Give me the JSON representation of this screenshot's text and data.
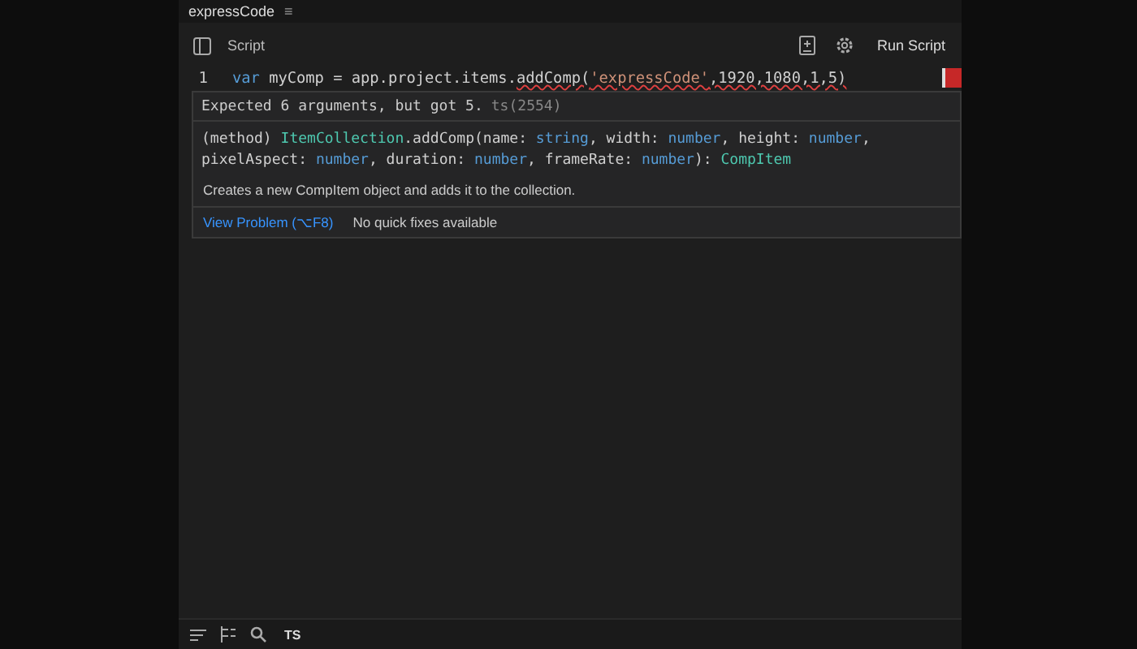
{
  "window": {
    "title": "expressCode",
    "menu_glyph": "≡"
  },
  "toolbar": {
    "label": "Script",
    "run_button": "Run Script"
  },
  "editor": {
    "lines": [
      {
        "number": "1",
        "has_error": true,
        "tokens": [
          {
            "kind": "keyword",
            "text": "var",
            "error": false
          },
          {
            "kind": "plain",
            "text": " myComp = app.project.items.",
            "error": false
          },
          {
            "kind": "plain",
            "text": "addComp(",
            "error": true
          },
          {
            "kind": "string",
            "text": "'expressCode'",
            "error": true
          },
          {
            "kind": "plain",
            "text": ",1920,1080,1,5)",
            "error": true
          }
        ]
      }
    ]
  },
  "tooltip": {
    "message": "Expected 6 arguments, but got 5.",
    "code": "ts(2554)",
    "signature": [
      {
        "kind": "plain",
        "text": "(method) "
      },
      {
        "kind": "type",
        "text": "ItemCollection"
      },
      {
        "kind": "plain",
        "text": ".addComp(name: "
      },
      {
        "kind": "keyword",
        "text": "string"
      },
      {
        "kind": "plain",
        "text": ", width: "
      },
      {
        "kind": "keyword",
        "text": "number"
      },
      {
        "kind": "plain",
        "text": ", height: "
      },
      {
        "kind": "keyword",
        "text": "number"
      },
      {
        "kind": "plain",
        "text": ", pixelAspect: "
      },
      {
        "kind": "keyword",
        "text": "number"
      },
      {
        "kind": "plain",
        "text": ", duration: "
      },
      {
        "kind": "keyword",
        "text": "number"
      },
      {
        "kind": "plain",
        "text": ", frameRate: "
      },
      {
        "kind": "keyword",
        "text": "number"
      },
      {
        "kind": "plain",
        "text": "): "
      },
      {
        "kind": "type",
        "text": "CompItem"
      }
    ],
    "description": "Creates a new CompItem object and adds it to the collection.",
    "link": "View Problem (⌥F8)",
    "note": "No quick fixes available"
  },
  "status_bar": {
    "language": "TS"
  }
}
